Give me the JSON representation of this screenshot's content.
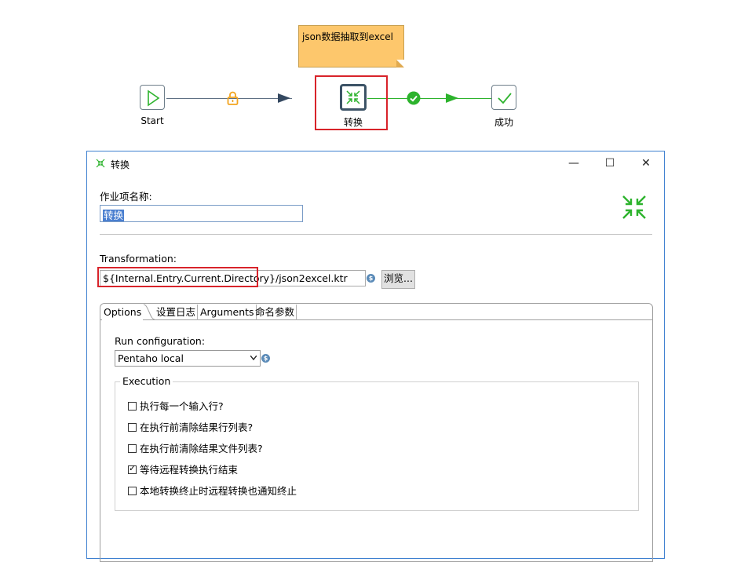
{
  "canvas": {
    "note_text": "json数据抽取到excel",
    "start_label": "Start",
    "transform_label": "转换",
    "success_label": "成功",
    "hop1_icon": "lock-icon",
    "hop2_icon": "check-circle-icon",
    "colors": {
      "hop_gray": "#5e7084",
      "hop_green": "#2db32d",
      "lock": "#f2a41e",
      "highlight": "#d8232a"
    }
  },
  "dialog": {
    "title": "转换",
    "minimize": "—",
    "maximize": "☐",
    "close": "✕",
    "job_entry_name_label": "作业项名称:",
    "job_entry_name_value": "转换",
    "transformation_label": "Transformation:",
    "transformation_path_var": "${Internal.Entry.Current.Directory}",
    "transformation_path_rest": "/json2excel.ktr",
    "browse_button": "浏览...",
    "variable_icon_text": "$",
    "tabs": [
      "Options",
      "设置日志",
      "Arguments",
      "命名参数"
    ],
    "run_config_label": "Run configuration:",
    "run_config_value": "Pentaho local",
    "execution_group": "Execution",
    "checkboxes": [
      {
        "label": "执行每一个输入行?",
        "checked": false
      },
      {
        "label": "在执行前清除结果行列表?",
        "checked": false
      },
      {
        "label": "在执行前清除结果文件列表?",
        "checked": false
      },
      {
        "label": "等待远程转换执行结束",
        "checked": true
      },
      {
        "label": "本地转换终止时远程转换也通知终止",
        "checked": false
      }
    ]
  }
}
